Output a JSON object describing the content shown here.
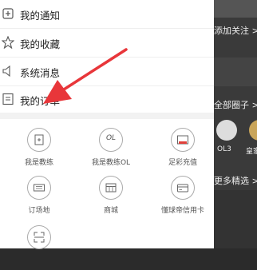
{
  "menu": [
    {
      "label": "我的通知",
      "icon": "bell-icon"
    },
    {
      "label": "我的收藏",
      "icon": "star-icon"
    },
    {
      "label": "系统消息",
      "icon": "speaker-icon"
    },
    {
      "label": "我的订单",
      "icon": "order-icon"
    }
  ],
  "grid": [
    {
      "label": "我是教练",
      "icon": "coach-icon"
    },
    {
      "label": "我是教练OL",
      "icon": "coach-ol-icon",
      "icon_text": "OL"
    },
    {
      "label": "足彩充值",
      "icon": "lottery-recharge-icon"
    },
    {
      "label": "订场地",
      "icon": "field-booking-icon"
    },
    {
      "label": "商城",
      "icon": "shop-icon"
    },
    {
      "label": "懂球帝信用卡",
      "icon": "credit-card-icon"
    },
    {
      "label": "",
      "icon": "scan-icon"
    }
  ],
  "background": {
    "add_follow": "添加关注 >",
    "all_circles": "全部圈子 >",
    "circle_short": "OL3",
    "circle_name": "皇家",
    "more_picks": "更多精选 >"
  },
  "colors": {
    "arrow": "#e8363a",
    "panel_bg": "#ffffff",
    "overlay_bg": "#3a3a3a"
  }
}
